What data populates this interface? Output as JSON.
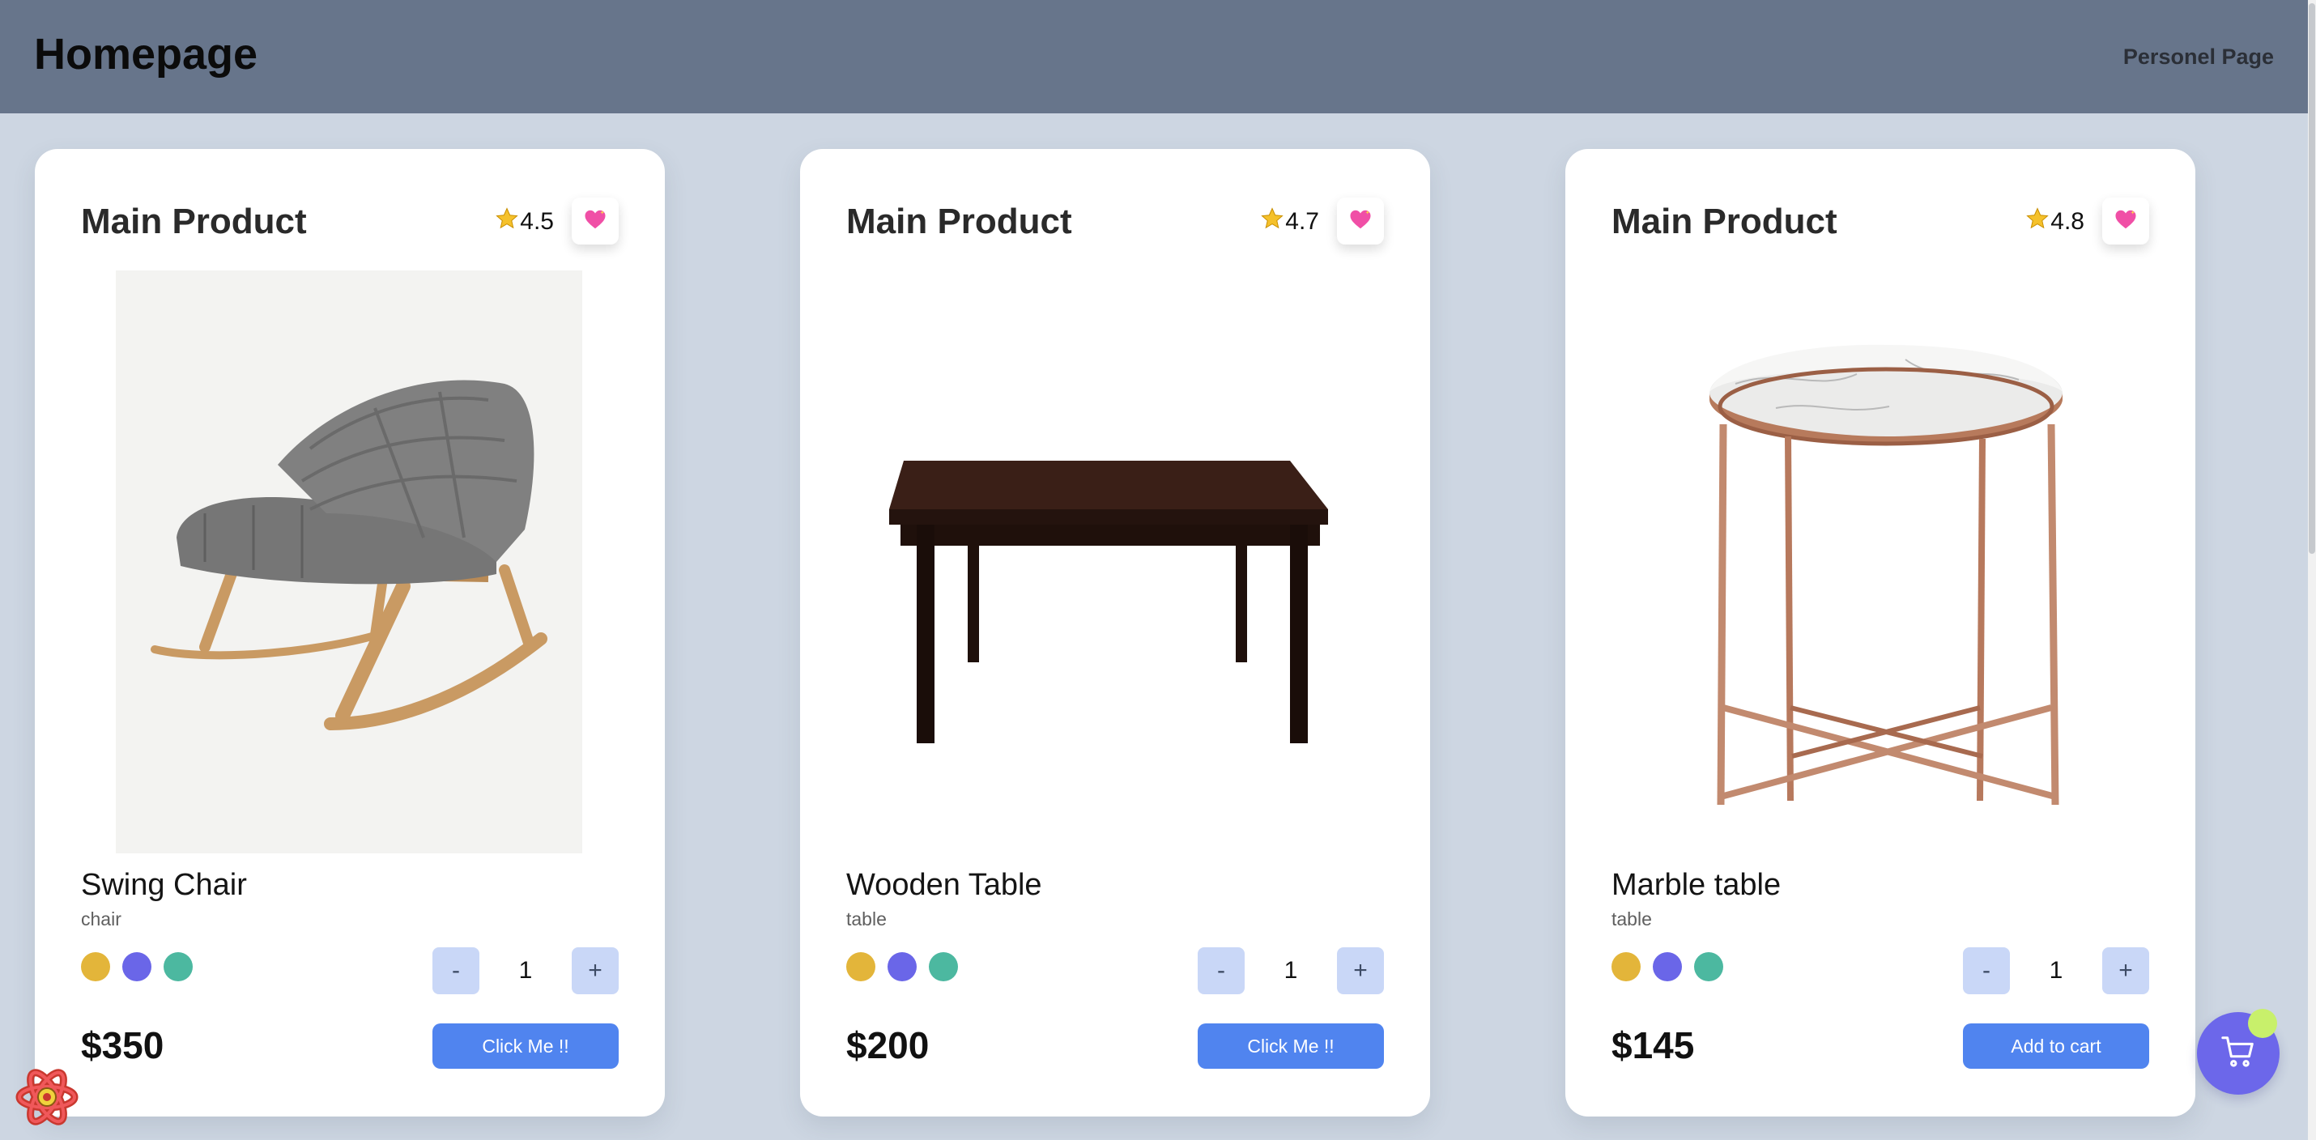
{
  "header": {
    "title": "Homepage",
    "nav_link": "Personel Page"
  },
  "products": [
    {
      "card_title": "Main Product",
      "rating": "4.5",
      "name": "Swing Chair",
      "category": "chair",
      "quantity": "1",
      "price": "$350",
      "button_label": "Click Me !!",
      "image": "rocking-chair-photo"
    },
    {
      "card_title": "Main Product",
      "rating": "4.7",
      "name": "Wooden Table",
      "category": "table",
      "quantity": "1",
      "price": "$200",
      "button_label": "Click Me !!",
      "image": "wooden-table-photo"
    },
    {
      "card_title": "Main Product",
      "rating": "4.8",
      "name": "Marble table",
      "category": "table",
      "quantity": "1",
      "price": "$145",
      "button_label": "Add to cart",
      "image": "marble-table-photo"
    }
  ],
  "stepper": {
    "minus": "-",
    "plus": "+"
  },
  "swatch_colors": [
    "#e3b53a",
    "#6a66e8",
    "#4cb8a0"
  ],
  "colors": {
    "header_bg": "#67758b",
    "page_bg": "#cdd6e2",
    "button_primary": "#5084ef",
    "stepper_bg": "#c9d7f7",
    "cart_fab": "#6c67ea",
    "cart_badge": "#c8f06b"
  },
  "icons": {
    "rating": "star-icon",
    "favorite": "heart-icon",
    "cart": "cart-icon",
    "devtools": "react-logo"
  }
}
